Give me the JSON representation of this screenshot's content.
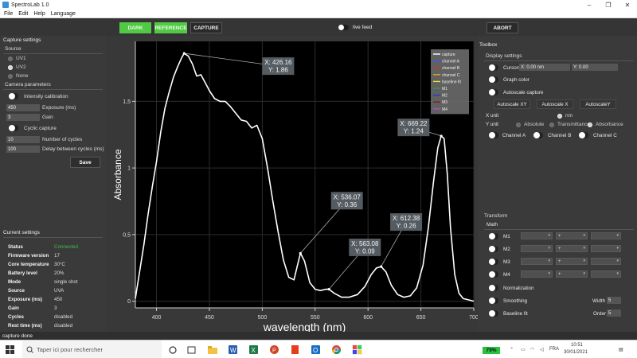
{
  "window": {
    "title": "SpectroLab 1.0"
  },
  "menu": [
    "File",
    "Edit",
    "Help",
    "Language"
  ],
  "topbar": {
    "dark": "DARK",
    "reference": "REFERENCE",
    "capture": "CAPTURE",
    "live_feed": "live feed",
    "abort": "ABORT"
  },
  "capture_settings": {
    "title": "Capture settings",
    "source_title": "Source",
    "sources": [
      {
        "label": "UV1",
        "selected": false
      },
      {
        "label": "UV2",
        "selected": true
      },
      {
        "label": "None",
        "selected": false
      }
    ],
    "camera_title": "Camera parameters",
    "intensity_calibration": "Intensity calibration",
    "exposure_value": "450",
    "exposure_label": "Exposure (ms)",
    "gain_value": "3",
    "gain_label": "Gain",
    "cyclic_capture": "Cyclic capture",
    "cycles_value": "10",
    "cycles_label": "Number of cycles",
    "delay_value": "100",
    "delay_label": "Delay between cycles (ms)",
    "save": "Save"
  },
  "current_settings": {
    "title": "Current settings",
    "rows": [
      {
        "key": "Status",
        "value": "Connected"
      },
      {
        "key": "Firmware version",
        "value": "17"
      },
      {
        "key": "Core temperature",
        "value": "30°C"
      },
      {
        "key": "Battery level",
        "value": "20%"
      },
      {
        "key": "Mode",
        "value": "single shot"
      },
      {
        "key": "Source",
        "value": "UVA"
      },
      {
        "key": "Exposure (ms)",
        "value": "450"
      },
      {
        "key": "Gain",
        "value": "3"
      },
      {
        "key": "Cycles",
        "value": "disabled"
      },
      {
        "key": "Rest time (ms)",
        "value": "disabled"
      }
    ]
  },
  "chart_data": {
    "type": "line",
    "xlabel": "wavelength (nm)",
    "ylabel": "Absorbance",
    "xlim": [
      380,
      700
    ],
    "ylim": [
      -0.05,
      1.95
    ],
    "x_ticks": [
      400,
      450,
      500,
      550,
      600,
      650,
      700
    ],
    "y_ticks": [
      "0",
      "0,5",
      "1",
      "1,5"
    ],
    "y_tick_values": [
      0,
      0.5,
      1,
      1.5
    ],
    "grid": true,
    "series": [
      {
        "name": "capture",
        "color": "#ffffff",
        "x": [
          380,
          384,
          388,
          392,
          396,
          400,
          404,
          408,
          412,
          416,
          420,
          424,
          426.16,
          430,
          434,
          438,
          442,
          446,
          450,
          455,
          460,
          465,
          470,
          475,
          480,
          485,
          490,
          495,
          500,
          505,
          510,
          515,
          520,
          525,
          530,
          533,
          536.07,
          540,
          545,
          550,
          555,
          560,
          563.08,
          568,
          575,
          582,
          590,
          597,
          603,
          608,
          612.38,
          617,
          622,
          628,
          634,
          640,
          646,
          652,
          657,
          662,
          666,
          669.22,
          672,
          675,
          678,
          682,
          686,
          690,
          695,
          700
        ],
        "y": [
          0.02,
          0.22,
          0.42,
          0.65,
          0.86,
          1.05,
          1.27,
          1.45,
          1.57,
          1.68,
          1.76,
          1.83,
          1.86,
          1.84,
          1.78,
          1.69,
          1.7,
          1.64,
          1.58,
          1.52,
          1.5,
          1.5,
          1.46,
          1.41,
          1.36,
          1.35,
          1.3,
          1.32,
          1.22,
          1.0,
          0.75,
          0.52,
          0.31,
          0.18,
          0.16,
          0.26,
          0.36,
          0.3,
          0.14,
          0.09,
          0.08,
          0.09,
          0.09,
          0.06,
          0.03,
          0.03,
          0.05,
          0.11,
          0.2,
          0.25,
          0.26,
          0.22,
          0.12,
          0.05,
          0.03,
          0.04,
          0.1,
          0.27,
          0.55,
          0.9,
          1.15,
          1.24,
          1.22,
          0.95,
          0.55,
          0.2,
          0.06,
          0.02,
          0.01,
          0.0
        ]
      }
    ],
    "annotations": [
      {
        "x": 426.16,
        "y": 1.86,
        "line1": "X: 426.16",
        "line2": "Y: 1.86",
        "box_x": 500,
        "box_y": 1.83
      },
      {
        "x": 669.22,
        "y": 1.24,
        "line1": "X: 669.22",
        "line2": "Y: 1.24",
        "box_x": 628,
        "box_y": 1.37
      },
      {
        "x": 536.07,
        "y": 0.36,
        "line1": "X: 536.07",
        "line2": "Y: 0.36",
        "box_x": 565,
        "box_y": 0.82
      },
      {
        "x": 563.08,
        "y": 0.09,
        "line1": "X: 563.08",
        "line2": "Y: 0.09",
        "box_x": 582,
        "box_y": 0.47
      },
      {
        "x": 612.38,
        "y": 0.26,
        "line1": "X: 612.38",
        "line2": "Y: 0.26",
        "box_x": 621,
        "box_y": 0.66
      }
    ],
    "legend": {
      "position": "top-right",
      "entries": [
        {
          "label": "capture",
          "color": "#ffffff"
        },
        {
          "label": "channel A",
          "color": "#2f5bff"
        },
        {
          "label": "channel B",
          "color": "#c0392b"
        },
        {
          "label": "channel C",
          "color": "#e6a02c"
        },
        {
          "label": "baseline fit",
          "color": "#e6e23a"
        },
        {
          "label": "M1",
          "color": "#2e9e4a"
        },
        {
          "label": "M2",
          "color": "#1f3fd0"
        },
        {
          "label": "M3",
          "color": "#7a1f1f"
        },
        {
          "label": "M4",
          "color": "#b04fd0"
        }
      ]
    }
  },
  "toolbox": {
    "title": "Toolbox",
    "display_title": "Display settings",
    "cursors": "Cursors",
    "cursor_x": "X: 0.00 nm",
    "cursor_y": "Y: 0.00",
    "graph_color": "Graph color",
    "autoscale_capture": "Autoscale capture",
    "autoscale_xy": "Autoscale XY",
    "autoscale_x": "Autoscale X",
    "autoscale_y": "AutoscaleY",
    "x_unit": "X unit",
    "x_unit_nm": "nm",
    "y_unit": "Y unit",
    "y_absolute": "Absolute",
    "y_transmittance": "Transmittance",
    "y_absorbance": "Absorbance",
    "channel_a": "Channel A",
    "channel_b": "Channel B",
    "channel_c": "Channel C",
    "transform_title": "Transform",
    "math_title": "Math",
    "math_rows": [
      "M1",
      "M2",
      "M3",
      "M4"
    ],
    "math_op": "+",
    "normalization": "Normalization",
    "smoothing": "Smoothing",
    "width_label": "Width",
    "width_value": "5",
    "baseline_fit": "Baseline fit",
    "order_label": "Order",
    "order_value": "5"
  },
  "statusbar": {
    "text": "capture done"
  },
  "taskbar": {
    "search_placeholder": "Taper ici pour rechercher",
    "battery": "79%",
    "language": "FRA",
    "time": "10:51",
    "date": "30/01/2021"
  }
}
